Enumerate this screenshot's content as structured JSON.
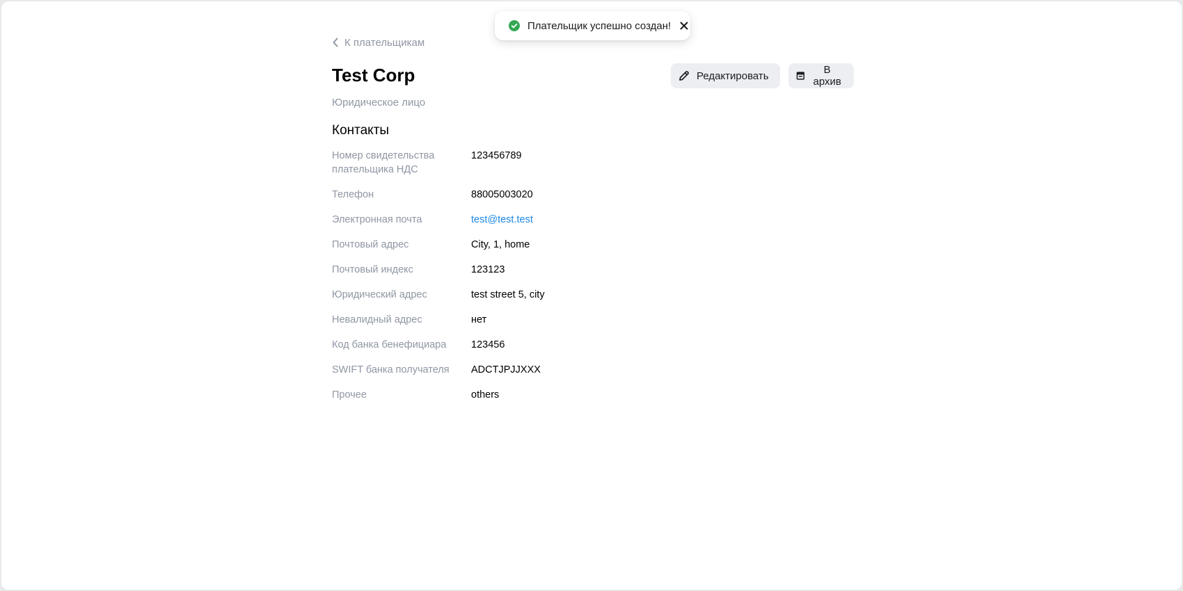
{
  "toast": {
    "message": "Плательщик успешно создан!",
    "icon": "check-circle-icon",
    "status_color": "#34a853"
  },
  "back_link": {
    "label": "К плательщикам",
    "icon": "chevron-left-icon"
  },
  "payer": {
    "name": "Test Corp",
    "type": "Юридическое лицо"
  },
  "actions": {
    "edit_label": "Редактировать",
    "edit_icon": "pencil-icon",
    "archive_label": "В архив",
    "archive_icon": "archive-icon"
  },
  "contacts": {
    "section_title": "Контакты",
    "fields": [
      {
        "label": "Номер свидетельства плательщика НДС",
        "value": "123456789"
      },
      {
        "label": "Телефон",
        "value": "88005003020"
      },
      {
        "label": "Электронная почта",
        "value": "test@test.test"
      },
      {
        "label": "Почтовый адрес",
        "value": "City, 1, home"
      },
      {
        "label": "Почтовый индекс",
        "value": "123123"
      },
      {
        "label": "Юридический адрес",
        "value": "test street 5, city"
      },
      {
        "label": "Невалидный адрес",
        "value": "нет"
      },
      {
        "label": "Код банка бенефициара",
        "value": "123456"
      },
      {
        "label": "SWIFT банка получателя",
        "value": "ADCTJPJJXXX"
      },
      {
        "label": "Прочее",
        "value": "others"
      }
    ]
  },
  "colors": {
    "muted_text": "#8f96a3",
    "link": "#1e88e5",
    "button_bg": "#eceef2"
  }
}
